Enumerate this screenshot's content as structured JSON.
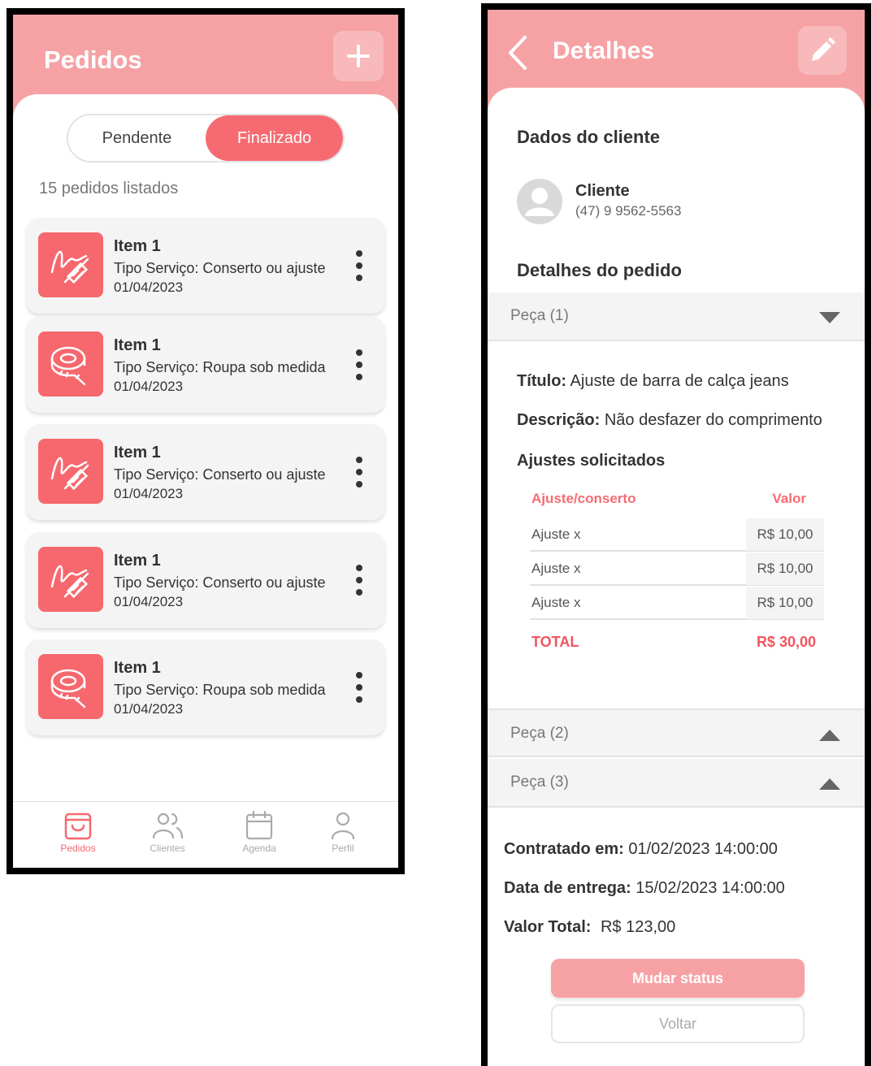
{
  "list_screen": {
    "title": "Pedidos",
    "add_icon": "plus-icon",
    "tabs": [
      {
        "label": "Pendente",
        "active": false
      },
      {
        "label": "Finalizado",
        "active": true
      }
    ],
    "count_text": "15 pedidos listados",
    "orders": [
      {
        "name": "Item 1",
        "type": "Tipo Serviço: Conserto ou ajuste",
        "date": "01/04/2023",
        "icon": "needle-thread-icon"
      },
      {
        "name": "Item 1",
        "type": "Tipo Serviço: Roupa sob medida",
        "date": "01/04/2023",
        "icon": "measuring-tape-icon"
      },
      {
        "name": "Item 1",
        "type": "Tipo Serviço: Conserto ou ajuste",
        "date": "01/04/2023",
        "icon": "needle-thread-icon"
      },
      {
        "name": "Item 1",
        "type": "Tipo Serviço: Conserto ou ajuste",
        "date": "01/04/2023",
        "icon": "needle-thread-icon"
      },
      {
        "name": "Item 1",
        "type": "Tipo Serviço: Roupa sob medida",
        "date": "01/04/2023",
        "icon": "measuring-tape-icon"
      }
    ],
    "nav": [
      {
        "label": "Pedidos",
        "icon": "shopping-bag-icon",
        "active": true
      },
      {
        "label": "Clientes",
        "icon": "users-icon",
        "active": false
      },
      {
        "label": "Agenda",
        "icon": "calendar-icon",
        "active": false
      },
      {
        "label": "Perfil",
        "icon": "user-icon",
        "active": false
      }
    ]
  },
  "detail_screen": {
    "title": "Detalhes",
    "client_section": "Dados do cliente",
    "client": {
      "name": "Cliente",
      "phone": "(47) 9 9562-5563"
    },
    "order_section": "Detalhes do pedido",
    "pieces": [
      {
        "label": "Peça (1)",
        "expanded": true
      },
      {
        "label": "Peça (2)",
        "expanded": false
      },
      {
        "label": "Peça (3)",
        "expanded": false
      }
    ],
    "piece1": {
      "title_label": "Título:",
      "title_value": "Ajuste de barra de calça jeans",
      "desc_label": "Descrição:",
      "desc_value": "Não desfazer do comprimento",
      "adjustments_title": "Ajustes solicitados",
      "col_name": "Ajuste/conserto",
      "col_value": "Valor",
      "rows": [
        {
          "name": "Ajuste x",
          "value": "R$ 10,00"
        },
        {
          "name": "Ajuste x",
          "value": "R$ 10,00"
        },
        {
          "name": "Ajuste x",
          "value": "R$ 10,00"
        }
      ],
      "total_label": "TOTAL",
      "total_value": "R$ 30,00"
    },
    "contracted_label": "Contratado em:",
    "contracted_value": "01/02/2023 14:00:00",
    "delivery_label": "Data de entrega:",
    "delivery_value": "15/02/2023 14:00:00",
    "total_label": "Valor Total:",
    "total_value": "R$ 123,00",
    "primary_button": "Mudar status",
    "secondary_button": "Voltar"
  },
  "colors": {
    "accent": "#f66b72",
    "header": "#f6a2a5"
  }
}
